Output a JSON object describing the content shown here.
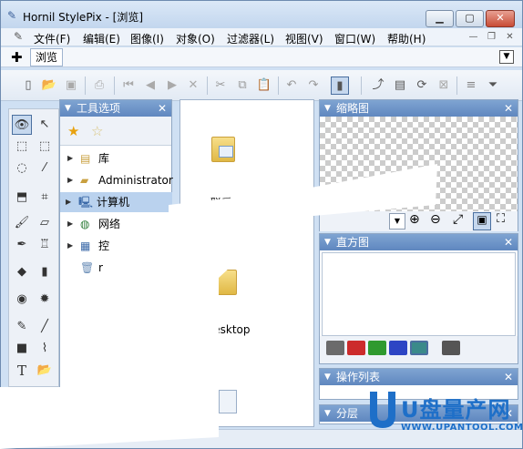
{
  "window": {
    "title": "Hornil StylePix - [浏览]",
    "icon": "pen-icon"
  },
  "menu": [
    "文件(F)",
    "编辑(E)",
    "图像(I)",
    "对象(O)",
    "过滤器(L)",
    "视图(V)",
    "窗口(W)",
    "帮助(H)"
  ],
  "tab": {
    "label": "浏览"
  },
  "tool_options": {
    "title": "工具选项"
  },
  "tree": [
    {
      "label": "库",
      "icon": "library-icon"
    },
    {
      "label": "Administrator",
      "icon": "user-folder-icon"
    },
    {
      "label": "计算机",
      "icon": "computer-icon",
      "selected": true
    },
    {
      "label": "网络",
      "icon": "network-icon"
    },
    {
      "label": "控",
      "icon": "control-panel-icon"
    },
    {
      "label": "r",
      "icon": "recycle-bin-icon"
    }
  ],
  "files": [
    {
      "label": "联系"
    },
    {
      "label": "Desktop"
    }
  ],
  "thumbnail_panel": {
    "title": "缩略图"
  },
  "histogram_panel": {
    "title": "直方图"
  },
  "actions_panel": {
    "title": "操作列表"
  },
  "layers_panel": {
    "title": "分层"
  },
  "watermark": {
    "brand": "U盘量产网",
    "url": "WWW.UPANTOOL.COM"
  },
  "colors": {
    "accent": "#5f87bf",
    "selection": "#bad2ee",
    "watermark": "#1e6fc8"
  }
}
